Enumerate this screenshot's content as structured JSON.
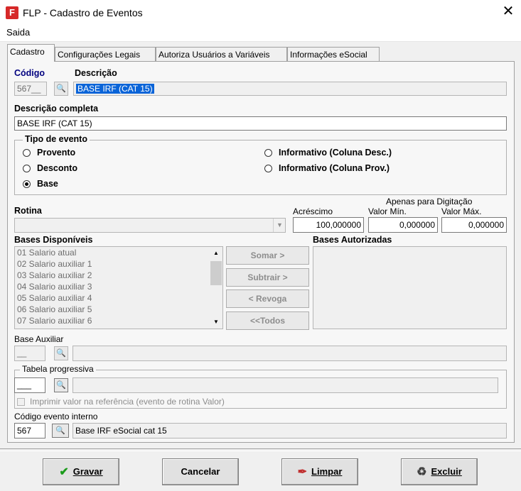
{
  "window": {
    "icon_text": "F",
    "title": "FLP - Cadastro de Eventos",
    "close": "✕"
  },
  "menu": {
    "saida": "Saida"
  },
  "tabs": [
    {
      "label": "Cadastro"
    },
    {
      "label": "Configurações Legais"
    },
    {
      "label": "Autoriza Usuários a Variáveis"
    },
    {
      "label": "Informações eSocial"
    }
  ],
  "cadastro": {
    "codigo_label": "Código",
    "codigo_value": "567__",
    "descricao_label": "Descrição",
    "descricao_value": "BASE IRF (CAT 15)",
    "descricao_completa_label": "Descrição completa",
    "descricao_completa_value": "BASE IRF (CAT 15)",
    "tipo_evento": {
      "title": "Tipo de evento",
      "options": [
        "Provento",
        "Desconto",
        "Base",
        "Informativo (Coluna Desc.)",
        "Informativo (Coluna Prov.)"
      ],
      "selected": "Base"
    },
    "rotina_label": "Rotina",
    "rotina_value": "",
    "apenas_digitacao": "Apenas para Digitação",
    "acrescimo_label": "Acréscimo",
    "acrescimo_value": "100,000000",
    "valor_min_label": "Valor Mín.",
    "valor_min_value": "0,000000",
    "valor_max_label": "Valor Máx.",
    "valor_max_value": "0,000000",
    "bases_disponiveis_label": "Bases Disponíveis",
    "bases_disponiveis": [
      "01 Salario atual",
      "02 Salario auxiliar 1",
      "03 Salario auxiliar 2",
      "04 Salario auxiliar 3",
      "05 Salario auxiliar 4",
      "06 Salario auxiliar 5",
      "07 Salario auxiliar 6"
    ],
    "bases_autorizadas_label": "Bases Autorizadas",
    "buttons": {
      "somar": "Somar >",
      "subtrair": "Subtrair >",
      "revoga": "< Revoga",
      "todos": "<<Todos"
    },
    "base_auxiliar_label": "Base Auxiliar",
    "base_auxiliar_value": "__",
    "tabela_progressiva": {
      "title": "Tabela progressiva",
      "value": "___",
      "checkbox_label": "Imprimir valor na referência (evento de rotina Valor)"
    },
    "codigo_interno_label": "Código evento interno",
    "codigo_interno_value": "567",
    "codigo_interno_desc": "Base IRF eSocial cat 15"
  },
  "footer": {
    "gravar": "Gravar",
    "cancelar": "Cancelar",
    "limpar": "Limpar",
    "excluir": "Excluir"
  },
  "colors": {
    "accent_label": "#00007f",
    "selection": "#0a64d8",
    "gravar_icon": "#1a9b1a"
  }
}
